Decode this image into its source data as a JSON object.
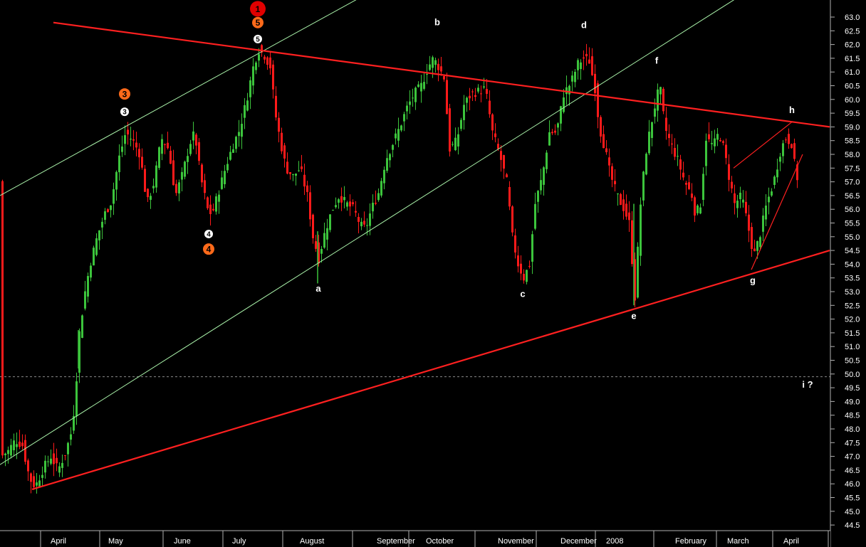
{
  "chart_data": {
    "type": "candlestick",
    "title": "",
    "xlabel": "",
    "ylabel": "",
    "ylim": [
      44.0,
      63.5
    ],
    "y_ticks": [
      "63.0",
      "62.5",
      "62.0",
      "61.5",
      "61.0",
      "60.5",
      "60.0",
      "59.5",
      "59.0",
      "58.5",
      "58.0",
      "57.5",
      "57.0",
      "56.5",
      "56.0",
      "55.5",
      "55.0",
      "54.5",
      "54.0",
      "53.5",
      "53.0",
      "52.5",
      "52.0",
      "51.5",
      "51.0",
      "50.5",
      "50.0",
      "49.5",
      "49.0",
      "48.5",
      "48.0",
      "47.5",
      "47.0",
      "46.5",
      "46.0",
      "45.5",
      "45.0",
      "44.5"
    ],
    "x_labels": [
      "April",
      "May",
      "June",
      "July",
      "August",
      "September",
      "October",
      "November",
      "December",
      "2008",
      "February",
      "March",
      "April"
    ],
    "colors": {
      "up": "#3cc43c",
      "down": "#ff1a1a",
      "trend": "#ff2020",
      "channel": "#a8f0a8",
      "background": "#000000"
    },
    "reference_line": {
      "value": 49.9,
      "style": "dashed"
    },
    "path": [
      [
        0,
        47.0
      ],
      [
        10,
        47.2
      ],
      [
        20,
        47.6
      ],
      [
        30,
        47.4
      ],
      [
        40,
        46.2
      ],
      [
        48,
        45.9
      ],
      [
        60,
        46.6
      ],
      [
        70,
        47.0
      ],
      [
        80,
        46.5
      ],
      [
        90,
        47.1
      ],
      [
        100,
        48.0
      ],
      [
        105,
        49.5
      ],
      [
        110,
        51.5
      ],
      [
        118,
        53.0
      ],
      [
        125,
        54.0
      ],
      [
        135,
        55.0
      ],
      [
        145,
        55.8
      ],
      [
        155,
        56.3
      ],
      [
        165,
        57.8
      ],
      [
        175,
        58.8
      ],
      [
        185,
        58.5
      ],
      [
        195,
        58.0
      ],
      [
        205,
        56.2
      ],
      [
        215,
        57.0
      ],
      [
        225,
        58.6
      ],
      [
        235,
        58.2
      ],
      [
        245,
        56.5
      ],
      [
        255,
        57.3
      ],
      [
        265,
        58.4
      ],
      [
        272,
        58.8
      ],
      [
        280,
        57.2
      ],
      [
        290,
        56.0
      ],
      [
        296,
        55.8
      ],
      [
        305,
        56.6
      ],
      [
        315,
        57.5
      ],
      [
        325,
        58.3
      ],
      [
        335,
        58.9
      ],
      [
        345,
        60.0
      ],
      [
        355,
        61.3
      ],
      [
        362,
        61.8
      ],
      [
        370,
        61.6
      ],
      [
        378,
        61.2
      ],
      [
        385,
        59.5
      ],
      [
        392,
        58.5
      ],
      [
        400,
        57.5
      ],
      [
        410,
        57.2
      ],
      [
        420,
        57.5
      ],
      [
        430,
        56.5
      ],
      [
        438,
        55.0
      ],
      [
        446,
        54.2
      ],
      [
        455,
        55.2
      ],
      [
        465,
        56.0
      ],
      [
        475,
        56.5
      ],
      [
        485,
        56.2
      ],
      [
        495,
        56.0
      ],
      [
        505,
        55.4
      ],
      [
        512,
        55.3
      ],
      [
        520,
        56.0
      ],
      [
        530,
        56.6
      ],
      [
        540,
        57.8
      ],
      [
        550,
        58.4
      ],
      [
        560,
        59.0
      ],
      [
        570,
        59.7
      ],
      [
        580,
        60.2
      ],
      [
        590,
        60.5
      ],
      [
        600,
        61.2
      ],
      [
        607,
        61.5
      ],
      [
        614,
        61.2
      ],
      [
        622,
        60.8
      ],
      [
        630,
        58.2
      ],
      [
        640,
        58.5
      ],
      [
        650,
        59.8
      ],
      [
        660,
        60.2
      ],
      [
        670,
        60.3
      ],
      [
        680,
        60.4
      ],
      [
        690,
        58.8
      ],
      [
        700,
        58.0
      ],
      [
        710,
        57.0
      ],
      [
        718,
        55.0
      ],
      [
        726,
        54.0
      ],
      [
        734,
        53.5
      ],
      [
        742,
        54.0
      ],
      [
        750,
        56.2
      ],
      [
        760,
        57.2
      ],
      [
        770,
        58.8
      ],
      [
        780,
        58.8
      ],
      [
        790,
        60.2
      ],
      [
        800,
        60.6
      ],
      [
        810,
        61.3
      ],
      [
        818,
        61.5
      ],
      [
        826,
        61.4
      ],
      [
        834,
        60.4
      ],
      [
        840,
        59.0
      ],
      [
        848,
        58.2
      ],
      [
        855,
        57.3
      ],
      [
        865,
        56.5
      ],
      [
        875,
        56.0
      ],
      [
        882,
        55.5
      ],
      [
        890,
        52.8
      ],
      [
        898,
        56.2
      ],
      [
        905,
        58.0
      ],
      [
        912,
        59.0
      ],
      [
        920,
        60.0
      ],
      [
        925,
        60.5
      ],
      [
        932,
        59.0
      ],
      [
        940,
        58.4
      ],
      [
        950,
        57.8
      ],
      [
        960,
        57.0
      ],
      [
        970,
        56.5
      ],
      [
        975,
        55.8
      ],
      [
        982,
        56.2
      ],
      [
        990,
        58.6
      ],
      [
        1000,
        58.3
      ],
      [
        1008,
        58.8
      ],
      [
        1015,
        58.2
      ],
      [
        1022,
        57.2
      ],
      [
        1030,
        56.2
      ],
      [
        1040,
        56.5
      ],
      [
        1048,
        55.5
      ],
      [
        1057,
        54.3
      ],
      [
        1065,
        55.0
      ],
      [
        1075,
        56.2
      ],
      [
        1085,
        57.0
      ],
      [
        1095,
        58.2
      ],
      [
        1102,
        58.6
      ],
      [
        1110,
        58.4
      ],
      [
        1116,
        57.3
      ],
      [
        1120,
        57.0
      ]
    ],
    "trendlines": [
      {
        "name": "upper-resistance",
        "from": [
          75,
          62.8
        ],
        "to": [
          1165,
          59.0
        ]
      },
      {
        "name": "lower-support",
        "from": [
          45,
          45.8
        ],
        "to": [
          1165,
          54.5
        ]
      },
      {
        "name": "triangle-upper",
        "from": [
          1030,
          57.5
        ],
        "to": [
          1113,
          59.2
        ]
      },
      {
        "name": "triangle-lower",
        "from": [
          1055,
          53.8
        ],
        "to": [
          1127,
          58.0
        ]
      }
    ],
    "channels": [
      {
        "name": "channel-upper",
        "from": [
          0,
          56.5
        ],
        "to": [
          505,
          63.7
        ]
      },
      {
        "name": "channel-lower",
        "from": [
          0,
          46.7
        ],
        "to": [
          1035,
          63.7
        ]
      }
    ],
    "wave_labels": [
      {
        "text": "a",
        "x": 447,
        "value": 53.0
      },
      {
        "text": "b",
        "x": 614,
        "value": 62.7
      },
      {
        "text": "c",
        "x": 734,
        "value": 52.8
      },
      {
        "text": "d",
        "x": 820,
        "value": 62.6
      },
      {
        "text": "e",
        "x": 890,
        "value": 52.0
      },
      {
        "text": "f",
        "x": 922,
        "value": 61.3
      },
      {
        "text": "g",
        "x": 1057,
        "value": 53.3
      },
      {
        "text": "h",
        "x": 1112,
        "value": 59.5
      },
      {
        "text": "i ?",
        "x": 1134,
        "value": 49.5
      }
    ],
    "wave_counts": [
      {
        "text": "1",
        "x": 362,
        "value": 63.3,
        "style": "red-large"
      },
      {
        "text": "5",
        "x": 362,
        "value": 62.8,
        "style": "orange"
      },
      {
        "text": "5",
        "x": 362,
        "value": 62.2,
        "style": "white"
      },
      {
        "text": "3",
        "x": 175,
        "value": 60.2,
        "style": "orange"
      },
      {
        "text": "3",
        "x": 175,
        "value": 59.55,
        "style": "white"
      },
      {
        "text": "4",
        "x": 293,
        "value": 55.1,
        "style": "white"
      },
      {
        "text": "4",
        "x": 293,
        "value": 54.55,
        "style": "orange"
      }
    ]
  }
}
